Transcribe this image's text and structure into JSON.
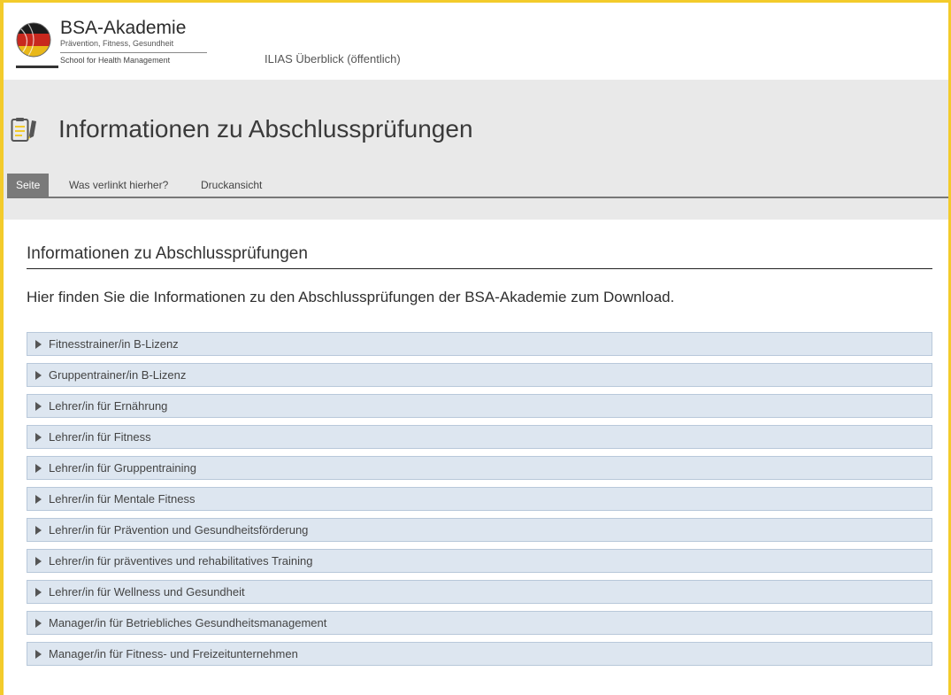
{
  "header": {
    "brand_title": "BSA-Akademie",
    "brand_subtitle": "Prävention, Fitness, Gesundheit",
    "brand_tagline": "School for Health Management",
    "nav_link": "ILIAS Überblick (öffentlich)"
  },
  "page": {
    "title": "Informationen zu Abschlussprüfungen",
    "icon": "page-edit-icon"
  },
  "tabs": [
    {
      "label": "Seite",
      "active": true
    },
    {
      "label": "Was verlinkt hierher?",
      "active": false
    },
    {
      "label": "Druckansicht",
      "active": false
    }
  ],
  "content": {
    "heading": "Informationen zu Abschlussprüfungen",
    "intro": "Hier finden Sie die Informationen zu den Abschlussprüfungen der BSA-Akademie zum Download.",
    "items": [
      "Fitnesstrainer/in B-Lizenz",
      "Gruppentrainer/in B-Lizenz",
      "Lehrer/in für Ernährung",
      "Lehrer/in für Fitness",
      "Lehrer/in für Gruppentraining",
      "Lehrer/in für Mentale Fitness",
      "Lehrer/in für Prävention und Gesundheitsförderung",
      "Lehrer/in für präventives und rehabilitatives Training",
      "Lehrer/in für Wellness und Gesundheit",
      "Manager/in für Betriebliches Gesundheitsmanagement",
      "Manager/in für Fitness- und Freizeitunternehmen"
    ]
  },
  "colors": {
    "frame": "#f3cb2b",
    "accordion_bg": "#dde6f0",
    "active_tab": "#7a7a7a"
  }
}
